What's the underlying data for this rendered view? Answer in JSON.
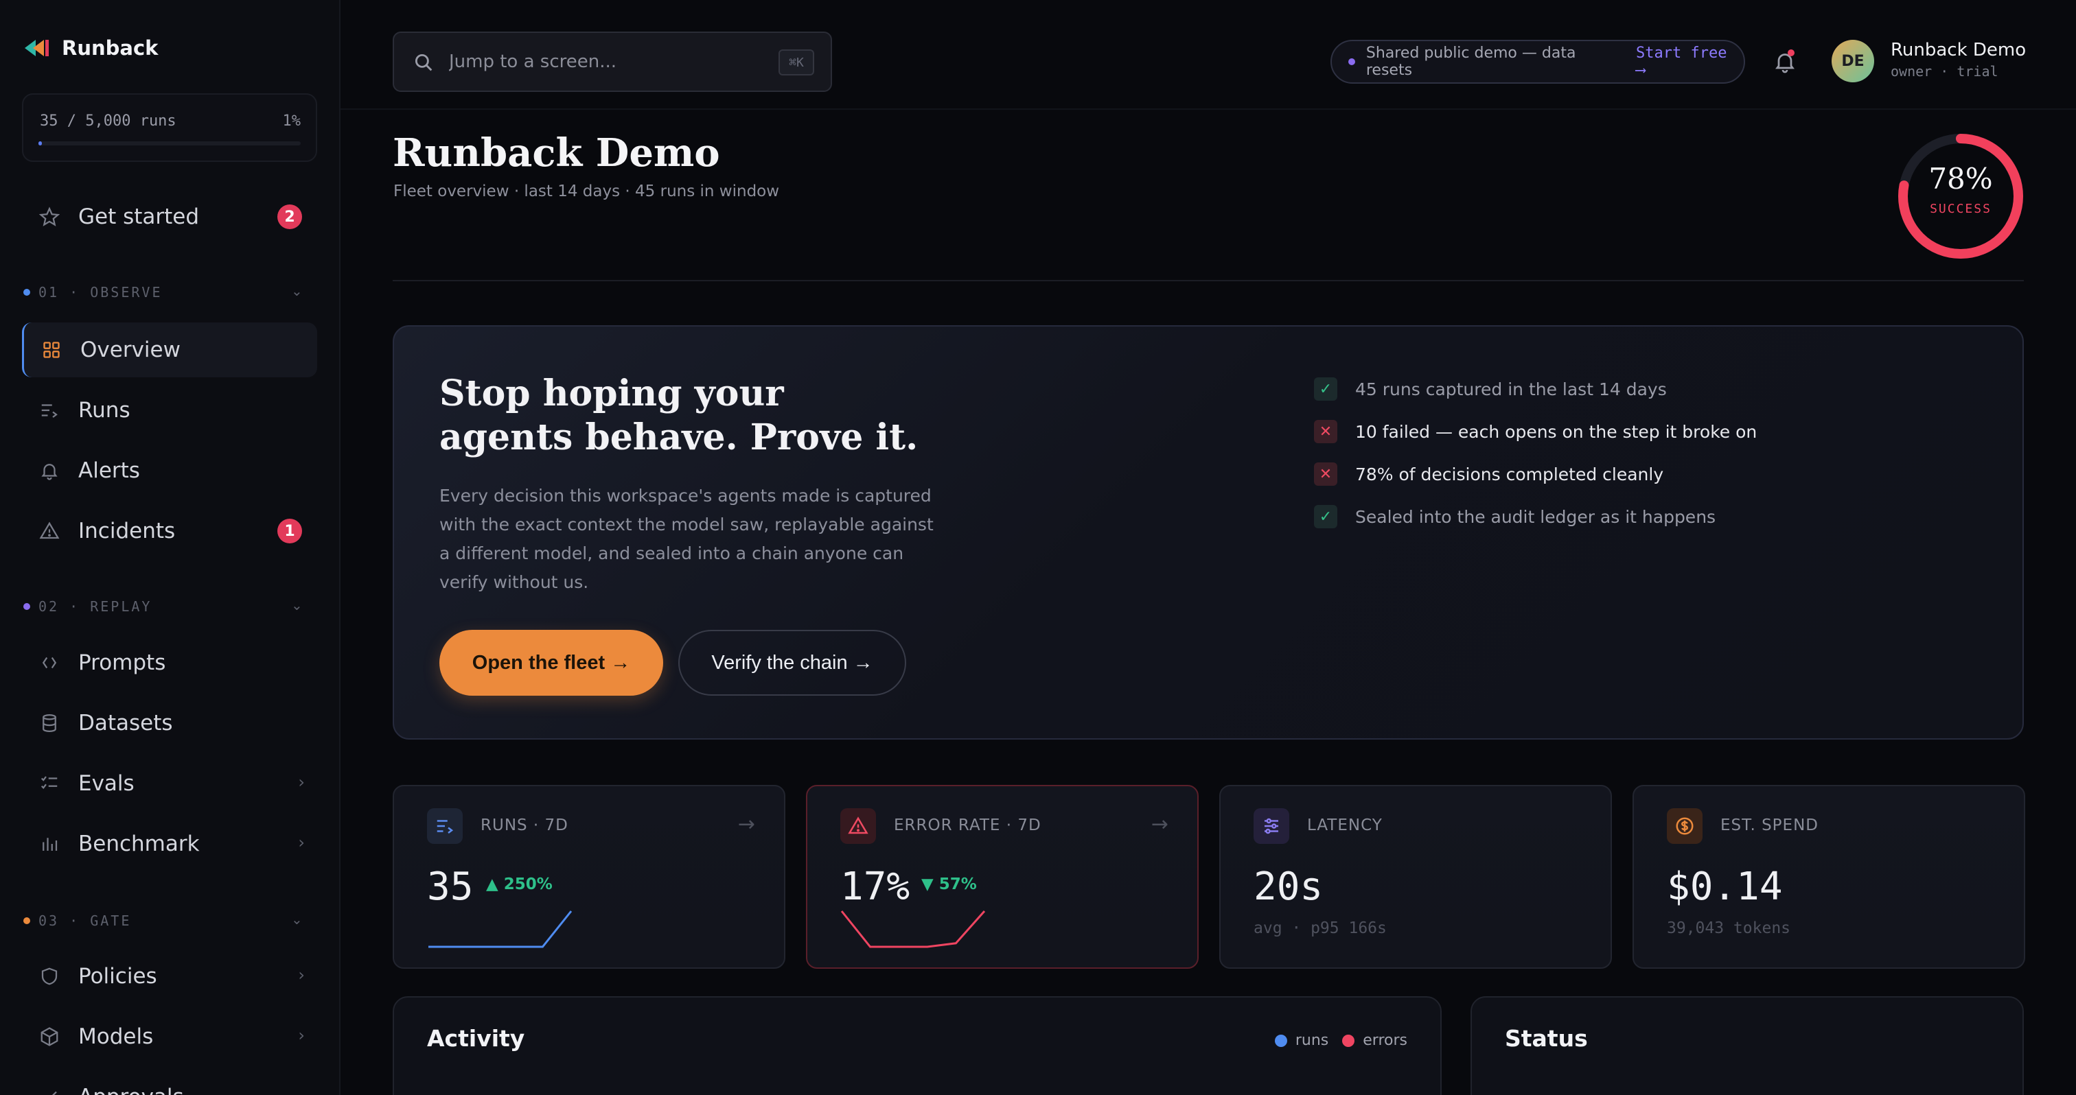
{
  "sidebar": {
    "brand": "Runback",
    "usage": {
      "label": "35 / 5,000 runs",
      "percent": "1%",
      "fraction": 0.01
    },
    "get_started": {
      "label": "Get started",
      "badge": "2"
    },
    "sections": [
      {
        "label": "01 · OBSERVE",
        "color": "#4f8cf0"
      },
      {
        "label": "02 · REPLAY",
        "color": "#8a6cf0"
      },
      {
        "label": "03 · GATE",
        "color": "#ec8a3c"
      }
    ],
    "observe_items": [
      {
        "label": "Overview",
        "icon": "grid-icon",
        "active": true
      },
      {
        "label": "Runs",
        "icon": "list-arrow-icon"
      },
      {
        "label": "Alerts",
        "icon": "bell-icon"
      },
      {
        "label": "Incidents",
        "icon": "warning-triangle-icon",
        "badge": "1"
      }
    ],
    "replay_items": [
      {
        "label": "Prompts",
        "icon": "code-brackets-icon"
      },
      {
        "label": "Datasets",
        "icon": "database-icon"
      },
      {
        "label": "Evals",
        "icon": "checklist-icon"
      },
      {
        "label": "Benchmark",
        "icon": "bar-chart-icon"
      }
    ],
    "gate_items": [
      {
        "label": "Policies",
        "icon": "shield-icon"
      },
      {
        "label": "Models",
        "icon": "cube-icon"
      },
      {
        "label": "Approvals",
        "icon": "check-icon"
      }
    ]
  },
  "topbar": {
    "search_placeholder": "Jump to a screen...",
    "shortcut": "⌘K",
    "demo_notice": "Shared public demo — data resets",
    "demo_cta": "Start free ⟶",
    "user": {
      "initials": "DE",
      "name": "Runback Demo",
      "role": "owner · trial"
    }
  },
  "header": {
    "title": "Runback Demo",
    "subtitle": "Fleet overview · last 14 days · 45 runs in window",
    "success_pct": "78%",
    "success_label": "SUCCESS",
    "success_fraction": 0.78
  },
  "hero": {
    "title_line1": "Stop hoping your",
    "title_line2": "agents behave. Prove it.",
    "body": "Every decision this workspace's agents made is captured with the exact context the model saw, replayable against a different model, and sealed into a chain anyone can verify without us.",
    "primary_cta": "Open the fleet →",
    "secondary_cta": "Verify the chain →",
    "checks": [
      {
        "text": "45 runs captured in the last 14 days",
        "status": "ok"
      },
      {
        "text": "10 failed — each opens on the step it broke on",
        "status": "bad"
      },
      {
        "text": "78% of decisions completed cleanly",
        "status": "bad"
      },
      {
        "text": "Sealed into the audit ledger as it happens",
        "status": "ok"
      }
    ]
  },
  "stats": [
    {
      "label": "RUNS · 7D",
      "value": "35",
      "delta": "▲ 250%",
      "icon": "list-arrow-icon",
      "spark": [
        0,
        0,
        0,
        0,
        0,
        1
      ]
    },
    {
      "label": "ERROR RATE · 7D",
      "value": "17%",
      "delta": "▼ 57%",
      "icon": "warning-triangle-icon",
      "spark": [
        1,
        0,
        0,
        0,
        0.1,
        1
      ]
    },
    {
      "label": "LATENCY",
      "value": "20s",
      "sub": "avg · p95 166s",
      "icon": "sliders-icon"
    },
    {
      "label": "EST. SPEND",
      "value": "$0.14",
      "sub": "39,043 tokens",
      "icon": "dollar-coin-icon"
    }
  ],
  "panels": {
    "activity_title": "Activity",
    "legend_runs": "runs",
    "legend_errors": "errors",
    "status_title": "Status"
  },
  "colors": {
    "accent_orange": "#ec8a3c",
    "accent_blue": "#4f8cf0",
    "danger": "#ef4561",
    "success": "#2ec08a"
  }
}
